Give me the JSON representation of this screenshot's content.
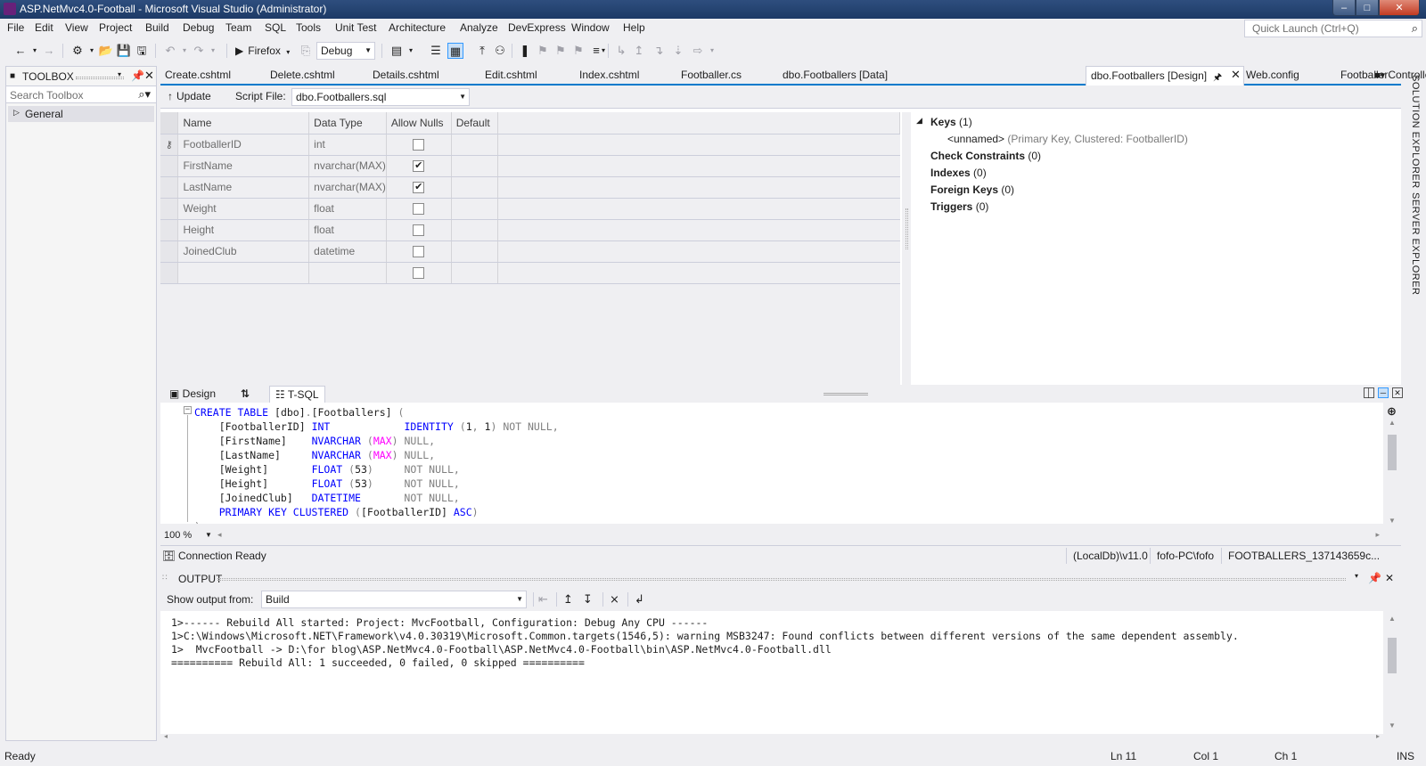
{
  "window": {
    "title": "ASP.NetMvc4.0-Football - Microsoft Visual Studio (Administrator)",
    "min": "‒",
    "max": "□",
    "close": "✕"
  },
  "menu": [
    "File",
    "Edit",
    "View",
    "Project",
    "Build",
    "Debug",
    "Team",
    "SQL",
    "Tools",
    "Unit Test",
    "Architecture",
    "Analyze",
    "DevExpress",
    "Window",
    "Help"
  ],
  "quick_launch": {
    "placeholder": "Quick Launch (Ctrl+Q)",
    "icon": "search-icon"
  },
  "toolbar": {
    "run_label": "Firefox",
    "config": "Debug"
  },
  "toolbox": {
    "title": "TOOLBOX",
    "search_placeholder": "Search Toolbox",
    "group": "General"
  },
  "doc_tabs": [
    "Create.cshtml",
    "Delete.cshtml",
    "Details.cshtml",
    "Edit.cshtml",
    "Index.cshtml",
    "Footballer.cs",
    "dbo.Footballers [Data]"
  ],
  "active_tab": "dbo.Footballers [Design]",
  "doc_tabs_after": [
    "Web.config",
    "FootballerController.cs"
  ],
  "designer": {
    "update_label": "Update",
    "script_file_label": "Script File:",
    "script_file": "dbo.Footballers.sql",
    "columns": [
      "Name",
      "Data Type",
      "Allow Nulls",
      "Default"
    ],
    "rows": [
      {
        "name": "FootballerID",
        "type": "int",
        "allow_nulls": false,
        "key": true
      },
      {
        "name": "FirstName",
        "type": "nvarchar(MAX)",
        "allow_nulls": true,
        "key": false
      },
      {
        "name": "LastName",
        "type": "nvarchar(MAX)",
        "allow_nulls": true,
        "key": false
      },
      {
        "name": "Weight",
        "type": "float",
        "allow_nulls": false,
        "key": false
      },
      {
        "name": "Height",
        "type": "float",
        "allow_nulls": false,
        "key": false
      },
      {
        "name": "JoinedClub",
        "type": "datetime",
        "allow_nulls": false,
        "key": false
      },
      {
        "name": "",
        "type": "",
        "allow_nulls": false,
        "key": false
      }
    ]
  },
  "keys_panel": {
    "keys_label": "Keys",
    "keys_count": "(1)",
    "key_name": "<unnamed>",
    "key_detail": "(Primary Key, Clustered: FootballerID)",
    "check_label": "Check Constraints",
    "check_count": "(0)",
    "indexes_label": "Indexes",
    "indexes_count": "(0)",
    "fk_label": "Foreign Keys",
    "fk_count": "(0)",
    "triggers_label": "Triggers",
    "triggers_count": "(0)"
  },
  "pane_tabs": {
    "design": "Design",
    "swap": "⇅",
    "tsql": "T-SQL"
  },
  "zoom": "100 %",
  "connection": {
    "status": "Connection Ready",
    "server": "(LocalDb)\\v11.0",
    "user": "fofo-PC\\fofo",
    "database": "FOOTBALLERS_137143659c..."
  },
  "output": {
    "title": "OUTPUT",
    "show_from_label": "Show output from:",
    "source": "Build",
    "lines": [
      "1>------ Rebuild All started: Project: MvcFootball, Configuration: Debug Any CPU ------",
      "1>C:\\Windows\\Microsoft.NET\\Framework\\v4.0.30319\\Microsoft.Common.targets(1546,5): warning MSB3247: Found conflicts between different versions of the same dependent assembly.",
      "1>  MvcFootball -> D:\\for blog\\ASP.NetMvc4.0-Football\\ASP.NetMvc4.0-Football\\bin\\ASP.NetMvc4.0-Football.dll",
      "========== Rebuild All: 1 succeeded, 0 failed, 0 skipped =========="
    ]
  },
  "side_tabs": [
    "SOLUTION EXPLORER",
    "SERVER EXPLORER"
  ],
  "status": {
    "ready": "Ready",
    "ln": "Ln 11",
    "col": "Col 1",
    "ch": "Ch 1",
    "ins": "INS"
  },
  "colors": {
    "accent": "#007acc",
    "keyword": "#0000ff",
    "function": "#ff00ff",
    "grey": "#808080"
  }
}
